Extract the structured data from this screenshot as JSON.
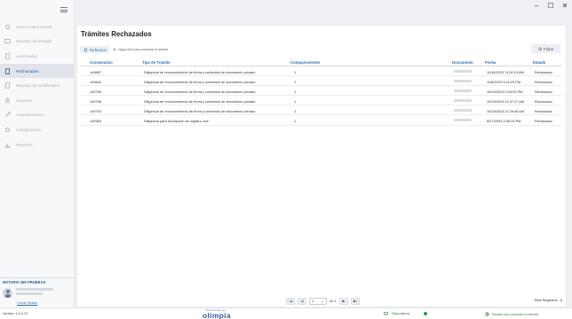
{
  "window": {
    "minimize": "–",
    "maximize": "☐",
    "close": "✕"
  },
  "sidebar": {
    "items": [
      {
        "label": "Iniciar nuevo trámite",
        "icon": "gear-icon"
      },
      {
        "label": "Bandeja de entrada",
        "icon": "inbox-icon"
      },
      {
        "label": "Autorizados",
        "icon": "document-icon"
      },
      {
        "label": "Rechazados",
        "icon": "document-icon"
      },
      {
        "label": "Bandeja de Modificados",
        "icon": "document-icon"
      },
      {
        "label": "Usuarios",
        "icon": "user-icon"
      },
      {
        "label": "Actualizaciones",
        "icon": "wrench-icon"
      },
      {
        "label": "Configuración",
        "icon": "gear-icon"
      },
      {
        "label": "Reportes",
        "icon": "chart-icon"
      }
    ],
    "active_index": 3,
    "notary_title": "NOTARIA 360 PRUEBAS",
    "logout_label": "Cerrar Sesión"
  },
  "main": {
    "title": "Trámites Rechazados",
    "refresh_label": "Refrescar",
    "hint": "Haga click para consultar el trámite",
    "filter_label": "Filtrar",
    "columns": [
      "Consecutivo",
      "Tipo de Trámite",
      "Comparecientes",
      "Documento",
      "Fecha",
      "Estado"
    ],
    "rows": [
      {
        "consecutivo": "149887",
        "tipo": "Diligencia de reconocimiento de firma y contenido de documento privado",
        "comparecientes": "1",
        "fecha": "11/16/2023 11:00:13 AM",
        "estado": "Rechazado"
      },
      {
        "consecutivo": "149842",
        "tipo": "Diligencia de reconocimiento de firma y contenido de documento privado",
        "comparecientes": "1",
        "fecha": "11/8/2023 3:44:20 PM",
        "estado": "Rechazado"
      },
      {
        "consecutivo": "149760",
        "tipo": "Diligencia de reconocimiento de firma y contenido de documento privado",
        "comparecientes": "1",
        "fecha": "10/24/2023 5:03:53 PM",
        "estado": "Rechazado"
      },
      {
        "consecutivo": "149756",
        "tipo": "Diligencia de reconocimiento de firma y contenido de documento privado",
        "comparecientes": "1",
        "fecha": "10/24/2023 11:37:27 AM",
        "estado": "Rechazado"
      },
      {
        "consecutivo": "149753",
        "tipo": "Diligencia de reconocimiento de firma y contenido de documento privado",
        "comparecientes": "1",
        "fecha": "10/24/2023 11:29:48 AM",
        "estado": "Rechazado"
      },
      {
        "consecutivo": "149383",
        "tipo": "Diligencia para Inscripción de registro civil",
        "comparecientes": "1",
        "fecha": "8/27/2023 2:08:13 PM",
        "estado": "Rechazado"
      }
    ],
    "pager": {
      "first": "|◀",
      "prev": "◀",
      "page": "1",
      "of_label": "de 1",
      "next": "▶",
      "last": "▶|"
    },
    "total_label": "Total Registros : 6"
  },
  "footer": {
    "version": "Versión: 1.0.0.22",
    "developed_by": "Desarrollado por:",
    "brand": "olimpia",
    "devices_label": "Dispositivos",
    "connection_label": "Estado con conexión a internet"
  },
  "colors": {
    "accent": "#2f6fb0",
    "active_nav": "#2f5f92",
    "ok": "#2e9b43"
  }
}
